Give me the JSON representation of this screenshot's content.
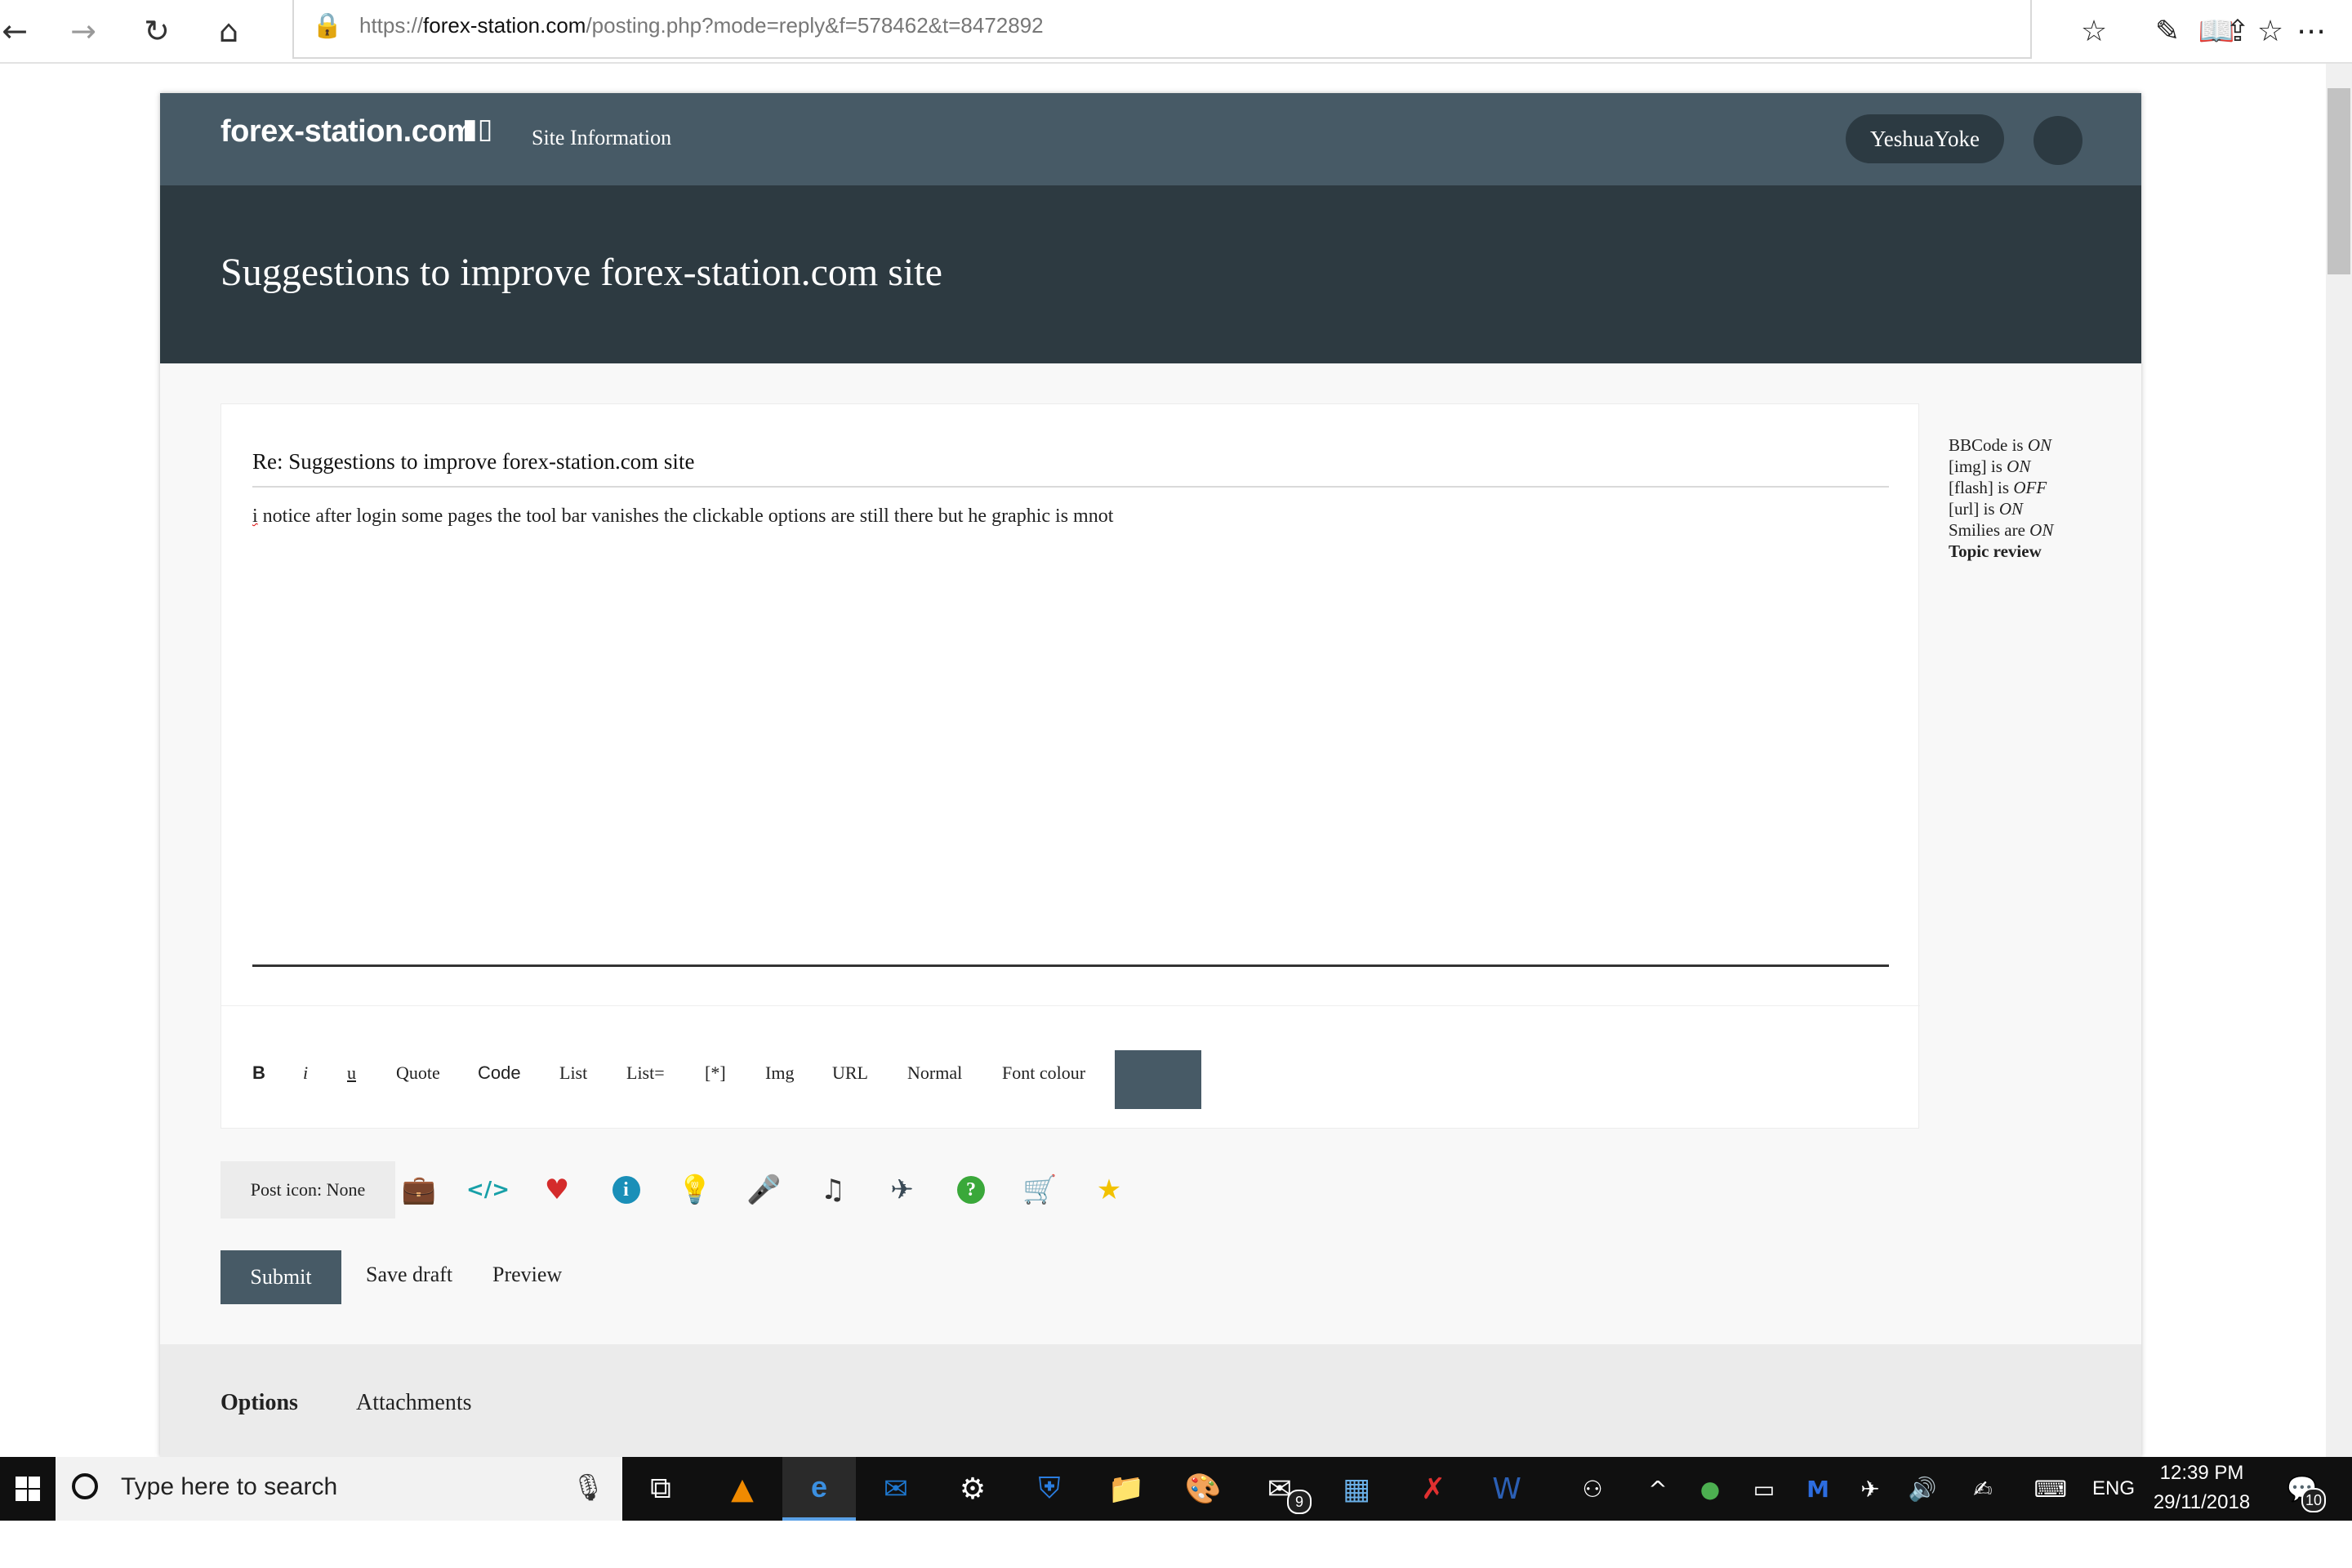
{
  "browser": {
    "url_scheme": "https://",
    "url_host": "forex-station.com",
    "url_path": "/posting.php?mode=reply&f=578462&t=8472892"
  },
  "site": {
    "logo": "forex-station.com",
    "nav_site_info": "Site Information",
    "username": "YeshuaYoke",
    "topic_title": "Suggestions to improve forex-station.com site"
  },
  "editor": {
    "subject": "Re: Suggestions to improve forex-station.com site",
    "message_first": "i",
    "message_rest": " notice after login some pages the tool bar vanishes the clickable options are still there but he graphic is mnot",
    "toolbar": {
      "bold": "B",
      "italic": "i",
      "underline": "u",
      "quote": "Quote",
      "code": "Code",
      "list": "List",
      "list_eq": "List=",
      "list_item": "[*]",
      "img": "Img",
      "url": "URL",
      "size": "Normal",
      "font_colour": "Font colour"
    },
    "color_swatch": "#475a66"
  },
  "sidebar": {
    "bbcode_label": "BBCode is ",
    "bbcode_val": "ON",
    "img_label": "[img] is ",
    "img_val": "ON",
    "flash_label": "[flash] is ",
    "flash_val": "OFF",
    "url_label": "[url] is ",
    "url_val": "ON",
    "smilies_label": "Smilies are ",
    "smilies_val": "ON",
    "topic_review": "Topic review"
  },
  "post_icons": {
    "label": "Post icon: None",
    "icons": [
      {
        "name": "briefcase-icon",
        "glyph": "💼",
        "color": "#7a3b1f"
      },
      {
        "name": "code-icon",
        "glyph": "</>",
        "color": "#18a0a8"
      },
      {
        "name": "heart-icon",
        "glyph": "♥",
        "color": "#d42b2b"
      },
      {
        "name": "info-icon",
        "glyph": "i",
        "color": "#1a8fb8"
      },
      {
        "name": "lightbulb-icon",
        "glyph": "💡",
        "color": "#e0b020"
      },
      {
        "name": "microphone-icon",
        "glyph": "🎤",
        "color": "#17a0a0"
      },
      {
        "name": "music-note-icon",
        "glyph": "♫",
        "color": "#333333"
      },
      {
        "name": "airplane-icon",
        "glyph": "✈",
        "color": "#3a4a56"
      },
      {
        "name": "question-icon",
        "glyph": "?",
        "color": "#3aa83a"
      },
      {
        "name": "cart-icon",
        "glyph": "🛒",
        "color": "#5a3a2a"
      },
      {
        "name": "star-icon",
        "glyph": "★",
        "color": "#f2c200"
      }
    ]
  },
  "actions": {
    "submit": "Submit",
    "save_draft": "Save draft",
    "preview": "Preview"
  },
  "tabs": {
    "options": "Options",
    "attachments": "Attachments"
  },
  "taskbar": {
    "search_placeholder": "Type here to search",
    "mail_badge": "9",
    "lang": "ENG",
    "time": "12:39 PM",
    "date": "29/11/2018",
    "notif_count": "10"
  }
}
